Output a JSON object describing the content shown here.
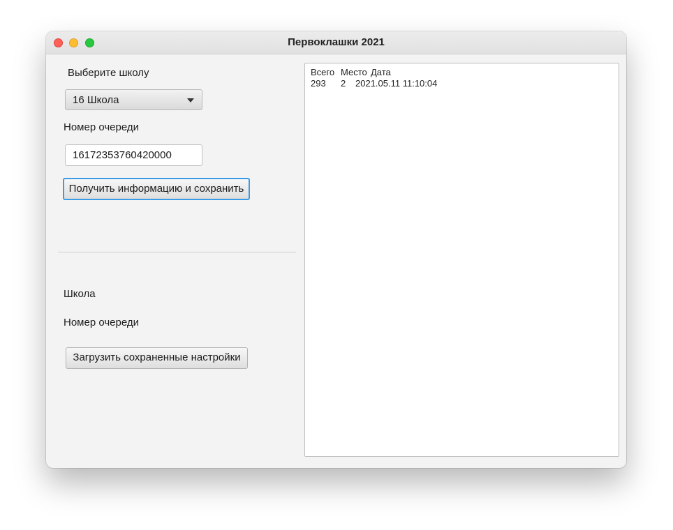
{
  "window": {
    "title": "Первоклашки 2021"
  },
  "form": {
    "choose_school_label": "Выберите школу",
    "school_select_value": "16 Школа",
    "queue_number_label": "Номер очереди",
    "queue_number_value": "16172353760420000",
    "get_info_button": "Получить информацию и сохранить"
  },
  "saved": {
    "school_label": "Школа",
    "queue_number_label": "Номер очереди",
    "load_button": "Загрузить сохраненные настройки"
  },
  "results": {
    "headers": [
      "Всего",
      "Место",
      "Дата"
    ],
    "rows": [
      [
        "293",
        "2",
        "2021.05.11 11:10:04"
      ]
    ]
  },
  "icons": {
    "close": "close-icon",
    "minimize": "minimize-icon",
    "zoom": "zoom-icon",
    "dropdown": "chevron-down-icon"
  },
  "colors": {
    "close": "#fe5f57",
    "minimize": "#febc2e",
    "zoom": "#28c840",
    "focus_ring": "#3c9be6"
  }
}
